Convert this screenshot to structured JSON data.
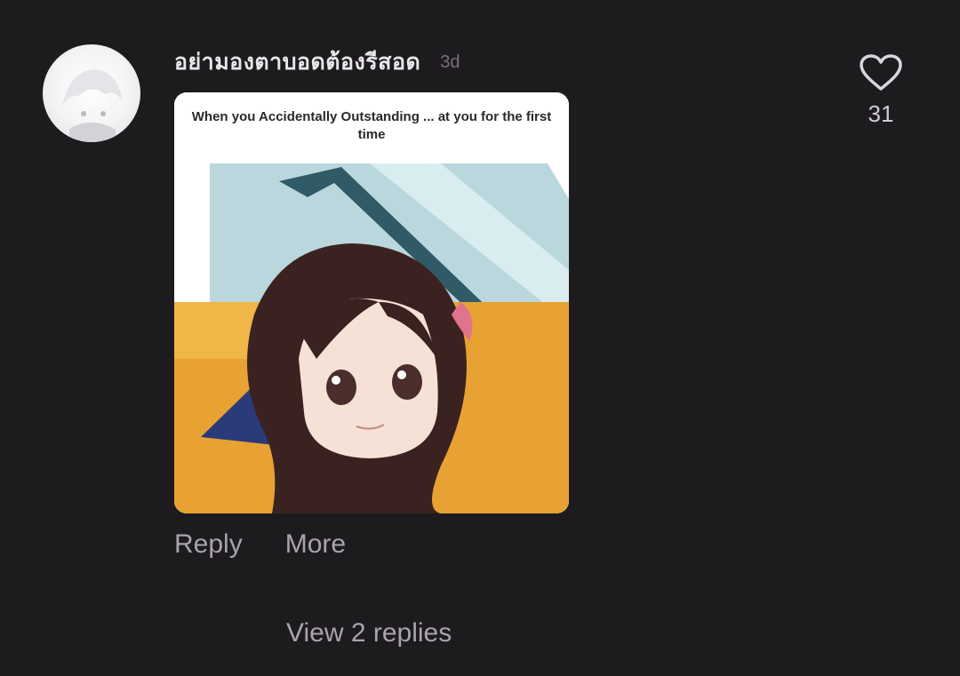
{
  "comment": {
    "username": "อย่ามองตาบอดต้องรีสอด",
    "timestamp": "3d",
    "sticker_caption": "When you Accidentally Outstanding ... at you for the first time",
    "like_count": "31",
    "like_icon": "heart-outline-icon",
    "actions": {
      "reply_label": "Reply",
      "more_label": "More"
    },
    "view_replies_label": "View 2 replies"
  },
  "colors": {
    "background": "#1e1b1f",
    "text_primary": "#e8e6e9",
    "text_secondary": "#a7a4aa",
    "sticker_orange": "#e8a233",
    "sticker_blue": "#a8cfd6"
  }
}
